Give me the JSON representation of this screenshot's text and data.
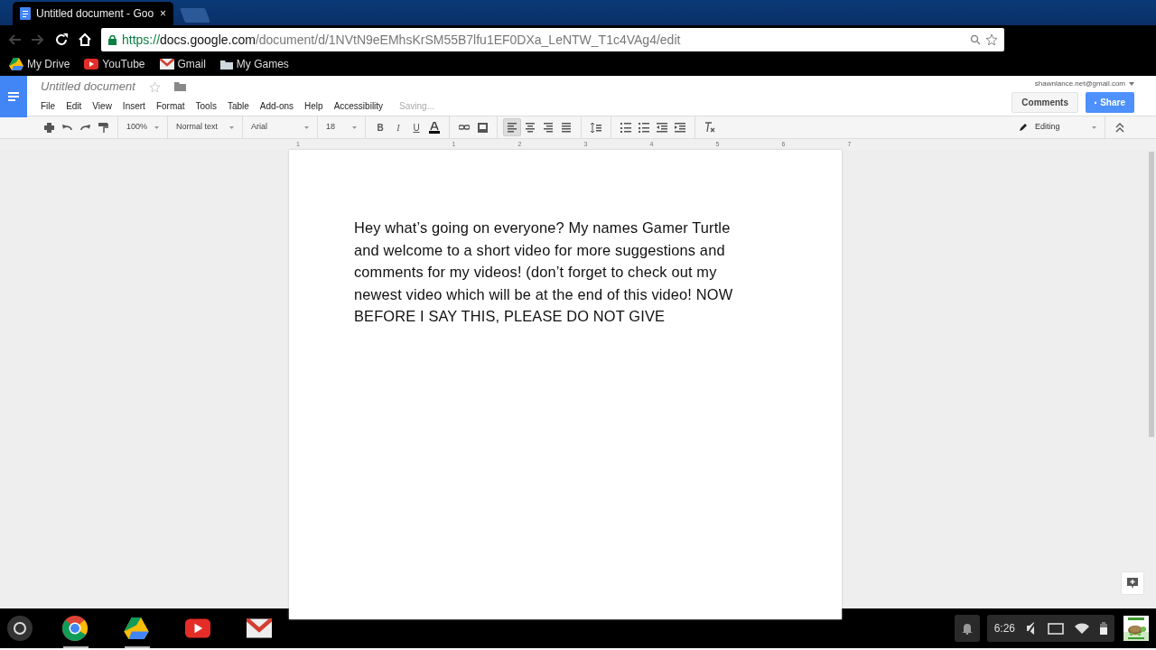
{
  "browser": {
    "tab": {
      "title": "Untitled document - Goo",
      "close": "×"
    },
    "url": {
      "scheme": "https://",
      "host": "docs.google.com",
      "path": "/document/d/1NVtN9eEMhsKrSM55B7lfu1EF0DXa_LeNTW_T1c4VAg4/edit"
    },
    "bookmarks": [
      {
        "label": "My Drive",
        "kind": "drive"
      },
      {
        "label": "YouTube",
        "kind": "youtube"
      },
      {
        "label": "Gmail",
        "kind": "gmail"
      },
      {
        "label": "My Games",
        "kind": "folder"
      }
    ]
  },
  "docs": {
    "title": "Untitled document",
    "starred": false,
    "menu": [
      "File",
      "Edit",
      "View",
      "Insert",
      "Format",
      "Tools",
      "Table",
      "Add-ons",
      "Help",
      "Accessibility"
    ],
    "save_status": "Saving...",
    "account": "shawnlance.net@gmail.com",
    "comments_button": "Comments",
    "share_button": "Share",
    "toolbar": {
      "zoom": "100%",
      "style": "Normal text",
      "font": "Arial",
      "size": "18",
      "format_buttons": [
        "B",
        "I",
        "U"
      ],
      "alignments": [
        {
          "kind": "left",
          "selected": true
        },
        {
          "kind": "center",
          "selected": false
        },
        {
          "kind": "right",
          "selected": false
        },
        {
          "kind": "justify",
          "selected": false
        }
      ],
      "mode": "Editing"
    }
  },
  "ruler": {
    "labels": [
      "1",
      "1",
      "2",
      "3",
      "4",
      "5",
      "6",
      "7"
    ]
  },
  "document": {
    "text": "Hey what’s going on everyone? My names Gamer Turtle and welcome to a short video for more suggestions and comments for my videos! (don’t forget to check out my newest video which will be at the end of this video! NOW BEFORE I SAY THIS, PLEASE DO NOT GIVE"
  },
  "shelf": {
    "apps": [
      {
        "kind": "chrome",
        "running": true
      },
      {
        "kind": "drive",
        "running": true
      },
      {
        "kind": "youtube",
        "running": false
      },
      {
        "kind": "gmail",
        "running": false
      }
    ],
    "time": "6:26"
  }
}
